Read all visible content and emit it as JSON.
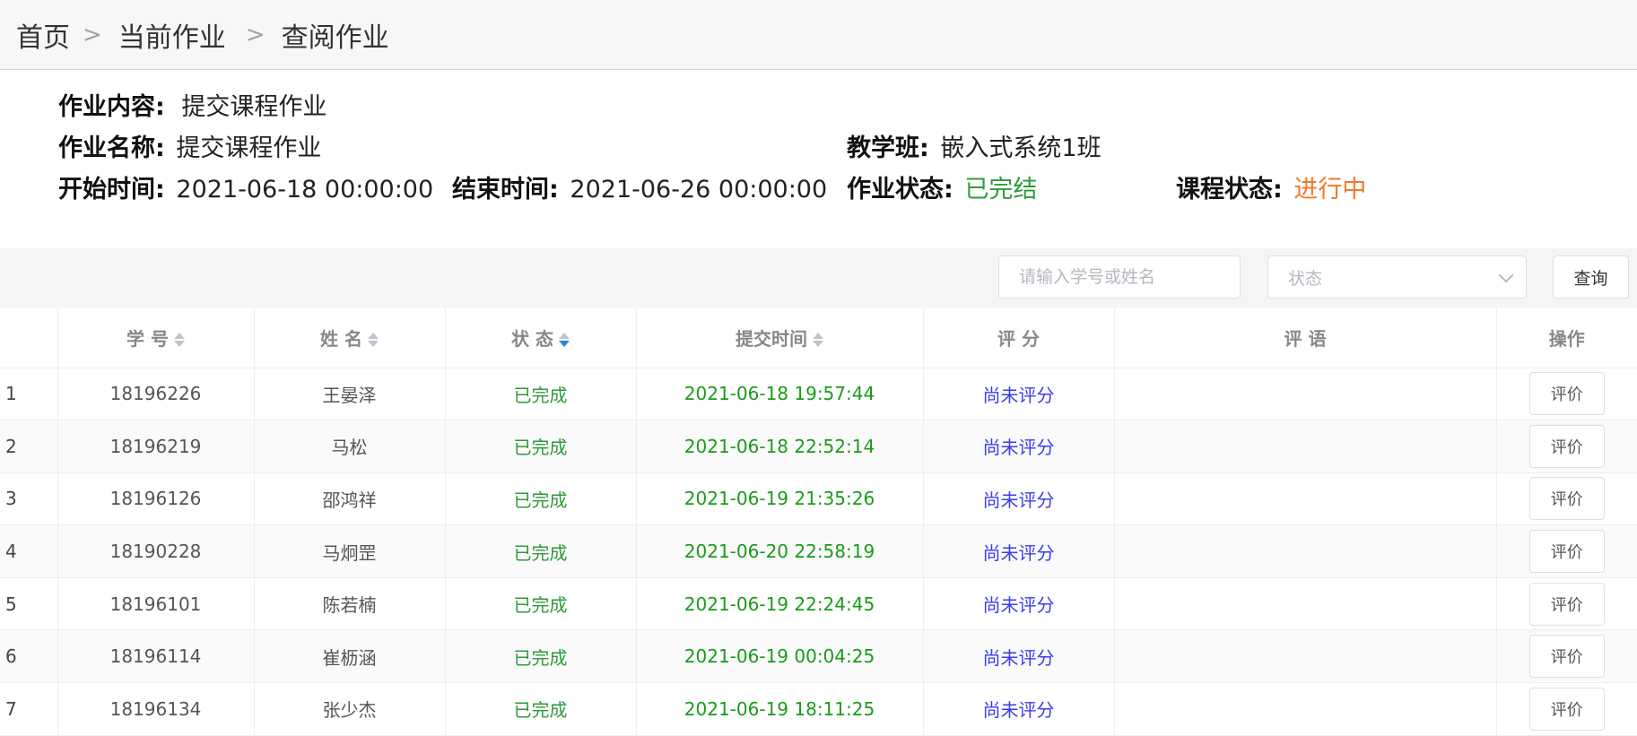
{
  "breadcrumb": {
    "items": [
      "首页",
      "当前作业",
      "查阅作业"
    ],
    "separator": ">"
  },
  "info": {
    "content_label": "作业内容:",
    "content_value": "提交课程作业",
    "name_label": "作业名称:",
    "name_value": "提交课程作业",
    "class_label": "教学班:",
    "class_value": "嵌入式系统1班",
    "start_label": "开始时间:",
    "start_value": "2021-06-18 00:00:00",
    "end_label": "结束时间:",
    "end_value": "2021-06-26 00:00:00",
    "hw_status_label": "作业状态:",
    "hw_status_value": "已完结",
    "course_status_label": "课程状态:",
    "course_status_value": "进行中"
  },
  "toolbar": {
    "search_placeholder": "请输入学号或姓名",
    "status_placeholder": "状态",
    "query_label": "查询"
  },
  "table": {
    "headers": {
      "student_id": "学 号",
      "name": "姓 名",
      "status": "状 态",
      "submit_time": "提交时间",
      "score": "评 分",
      "comment": "评 语",
      "action": "操作"
    },
    "action_label": "评价",
    "rows": [
      {
        "index": "1",
        "student_id": "18196226",
        "name": "王晏泽",
        "status": "已完成",
        "submit_time": "2021-06-18 19:57:44",
        "score": "尚未评分",
        "comment": ""
      },
      {
        "index": "2",
        "student_id": "18196219",
        "name": "马松",
        "status": "已完成",
        "submit_time": "2021-06-18 22:52:14",
        "score": "尚未评分",
        "comment": ""
      },
      {
        "index": "3",
        "student_id": "18196126",
        "name": "邵鸿祥",
        "status": "已完成",
        "submit_time": "2021-06-19 21:35:26",
        "score": "尚未评分",
        "comment": ""
      },
      {
        "index": "4",
        "student_id": "18190228",
        "name": "马炯罡",
        "status": "已完成",
        "submit_time": "2021-06-20 22:58:19",
        "score": "尚未评分",
        "comment": ""
      },
      {
        "index": "5",
        "student_id": "18196101",
        "name": "陈若楠",
        "status": "已完成",
        "submit_time": "2021-06-19 22:24:45",
        "score": "尚未评分",
        "comment": ""
      },
      {
        "index": "6",
        "student_id": "18196114",
        "name": "崔枥涵",
        "status": "已完成",
        "submit_time": "2021-06-19 00:04:25",
        "score": "尚未评分",
        "comment": ""
      },
      {
        "index": "7",
        "student_id": "18196134",
        "name": "张少杰",
        "status": "已完成",
        "submit_time": "2021-06-19 18:11:25",
        "score": "尚未评分",
        "comment": ""
      }
    ]
  },
  "colors": {
    "status_green": "#2e9a3a",
    "time_green": "#1a9b1a",
    "score_blue": "#3b3bf0",
    "course_orange": "#ef7a2a",
    "sort_active": "#2f86d4"
  }
}
